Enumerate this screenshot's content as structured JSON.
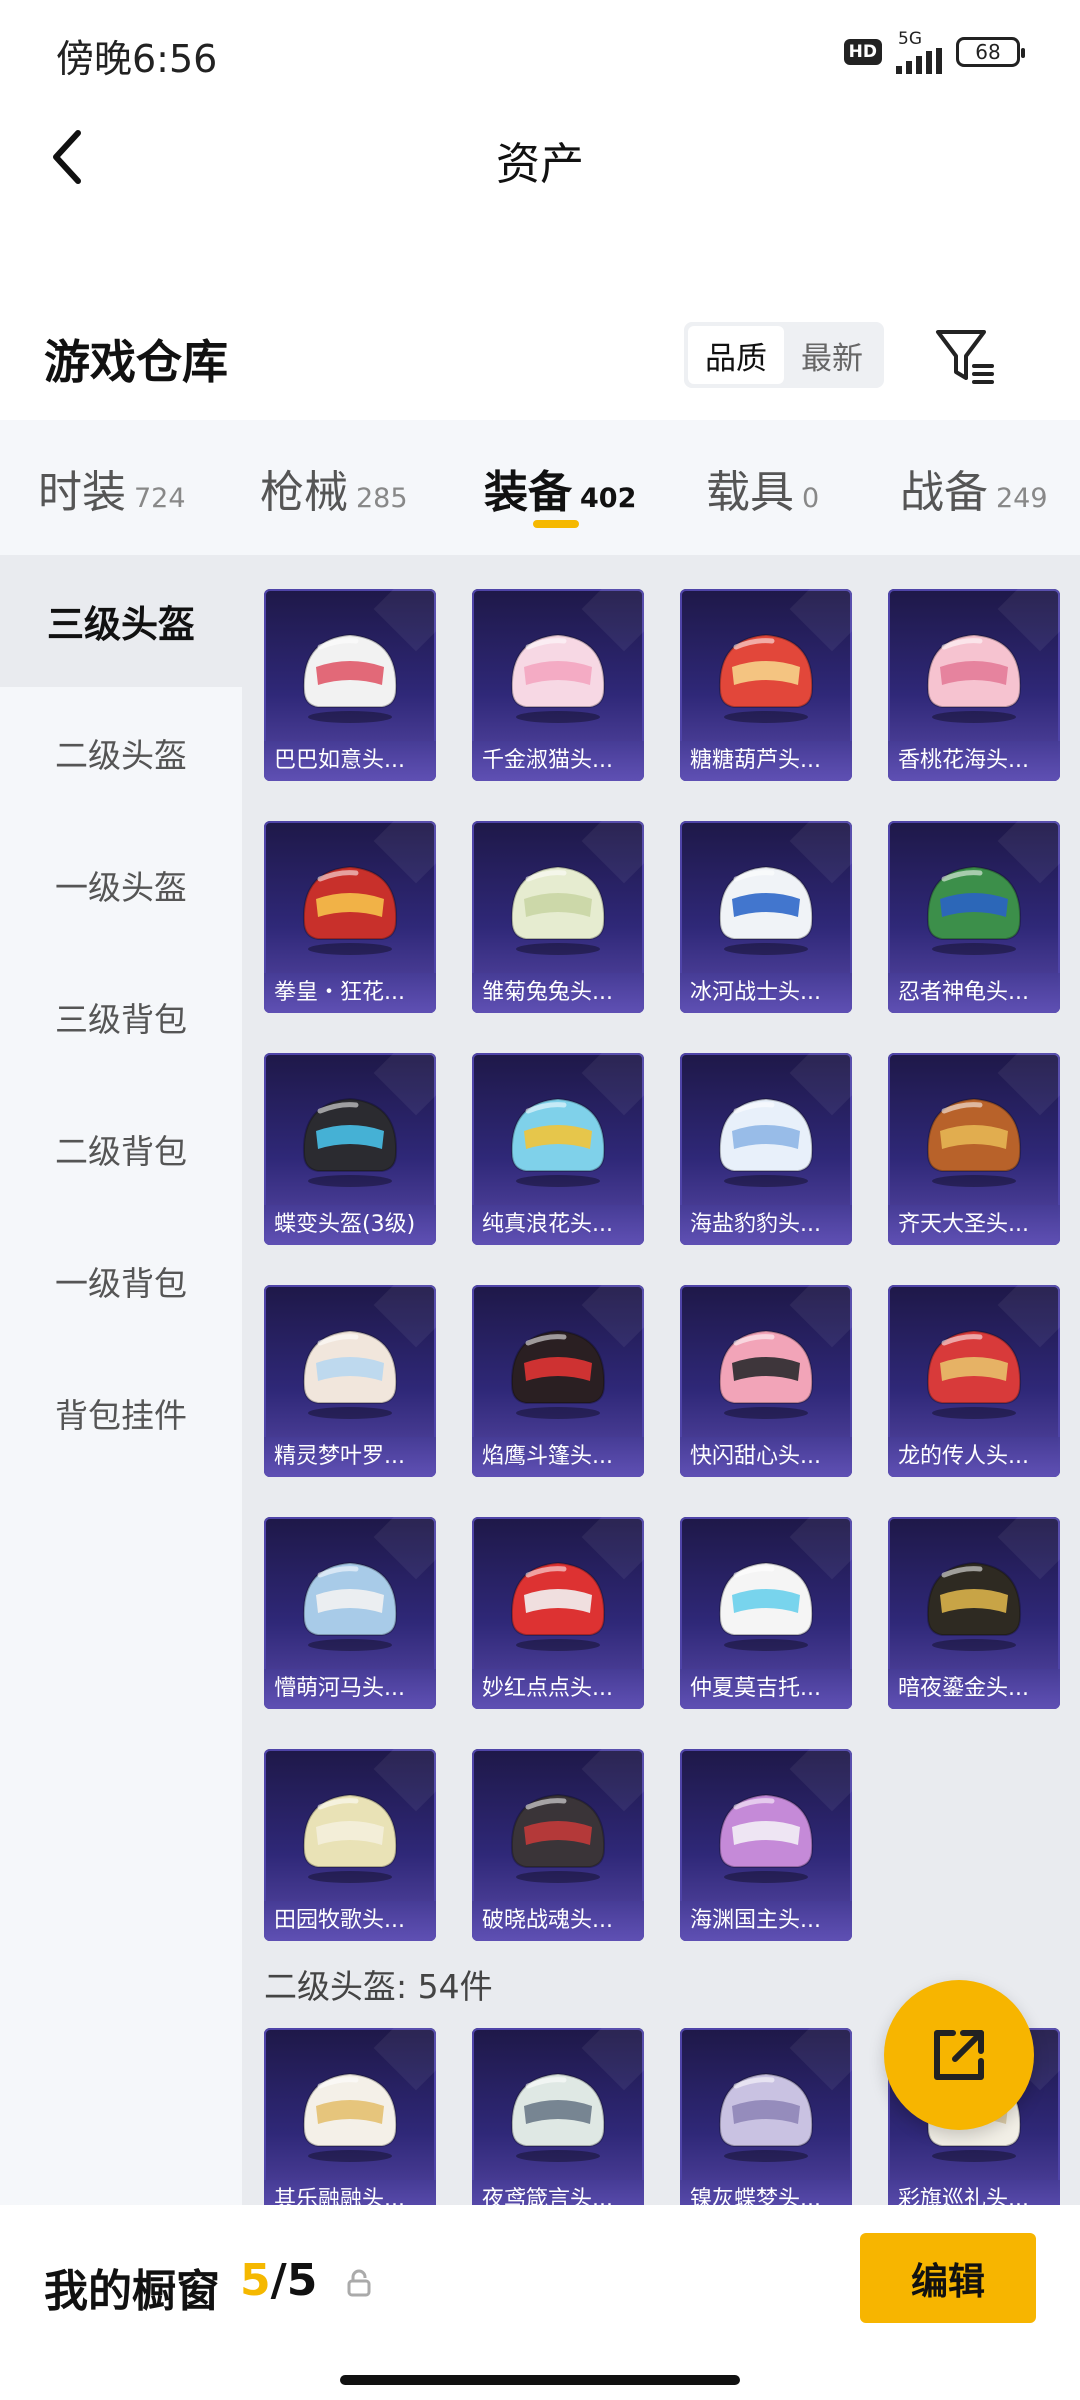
{
  "status_bar": {
    "time": "傍晚6:56",
    "hd": "HD",
    "network": "5G",
    "battery": "68"
  },
  "header": {
    "title": "资产"
  },
  "warehouse": {
    "title": "游戏仓库",
    "sort_options": [
      "品质",
      "最新"
    ],
    "active_sort": "品质"
  },
  "category_tabs": [
    {
      "label": "时装",
      "count": "724"
    },
    {
      "label": "枪械",
      "count": "285"
    },
    {
      "label": "装备",
      "count": "402",
      "active": true
    },
    {
      "label": "载具",
      "count": "0"
    },
    {
      "label": "战备",
      "count": "249"
    }
  ],
  "sidebar": {
    "items": [
      {
        "label": "三级头盔",
        "active": true
      },
      {
        "label": "二级头盔"
      },
      {
        "label": "一级头盔"
      },
      {
        "label": "三级背包"
      },
      {
        "label": "二级背包"
      },
      {
        "label": "一级背包"
      },
      {
        "label": "背包挂件"
      }
    ]
  },
  "items": [
    {
      "name": "巴巴如意头...",
      "color": "#f2f2f2",
      "accent": "#e05a6a"
    },
    {
      "name": "千金淑猫头...",
      "color": "#f7d8e4",
      "accent": "#f3a6c0"
    },
    {
      "name": "糖糖葫芦头...",
      "color": "#e2473a",
      "accent": "#f6d28a"
    },
    {
      "name": "香桃花海头...",
      "color": "#f6c3d0",
      "accent": "#e47c98"
    },
    {
      "name": "拳皇・狂花...",
      "color": "#c8302b",
      "accent": "#f5c14a"
    },
    {
      "name": "雏菊兔兔头...",
      "color": "#e6ecd0",
      "accent": "#c9d6a4"
    },
    {
      "name": "冰河战士头...",
      "color": "#f0f3f7",
      "accent": "#2f68c9"
    },
    {
      "name": "忍者神龟头...",
      "color": "#3c8f4a",
      "accent": "#2a63c4"
    },
    {
      "name": "蝶变头盔(3级)",
      "color": "#2b2b30",
      "accent": "#48c0e8"
    },
    {
      "name": "纯真浪花头...",
      "color": "#7fd1ea",
      "accent": "#f2c43a"
    },
    {
      "name": "海盐豹豹头...",
      "color": "#e8f0fa",
      "accent": "#8fb6e6"
    },
    {
      "name": "齐天大圣头...",
      "color": "#b8622a",
      "accent": "#e6b653"
    },
    {
      "name": "精灵梦叶罗...",
      "color": "#f1e6dc",
      "accent": "#b8d7f0"
    },
    {
      "name": "焰鹰斗篷头...",
      "color": "#2a1f22",
      "accent": "#e03434"
    },
    {
      "name": "快闪甜心头...",
      "color": "#f2a4b8",
      "accent": "#2a2a2e"
    },
    {
      "name": "龙的传人头...",
      "color": "#d83a3a",
      "accent": "#e8c06a"
    },
    {
      "name": "懵萌河马头...",
      "color": "#a8cbe8",
      "accent": "#f2f2f2"
    },
    {
      "name": "妙红点点头...",
      "color": "#dd3232",
      "accent": "#f2f2f2"
    },
    {
      "name": "仲夏莫吉托...",
      "color": "#f5f5f5",
      "accent": "#6ad0ec"
    },
    {
      "name": "暗夜鎏金头...",
      "color": "#2e2a22",
      "accent": "#d9b14a"
    },
    {
      "name": "田园牧歌头...",
      "color": "#e9e2b6",
      "accent": "#f4f0dc"
    },
    {
      "name": "破晓战魂头...",
      "color": "#3a3438",
      "accent": "#c23a3a"
    },
    {
      "name": "海渊国主头...",
      "color": "#c58ad8",
      "accent": "#f2eef6"
    }
  ],
  "section_level2": {
    "title": "二级头盔: 54件"
  },
  "items_level2": [
    {
      "name": "其乐融融头...",
      "color": "#f4f0e8",
      "accent": "#e4c070"
    },
    {
      "name": "夜鸢箴言头...",
      "color": "#dfe8e4",
      "accent": "#6c7a88"
    },
    {
      "name": "镍灰蝶梦头...",
      "color": "#c9c2e2",
      "accent": "#8f86b8"
    },
    {
      "name": "彩旗巡礼头...",
      "color": "#f2efe6",
      "accent": "#d8c6a0"
    }
  ],
  "bottom_bar": {
    "label": "我的橱窗",
    "current": "5",
    "separator": "/",
    "total": "5",
    "edit_label": "编辑"
  },
  "colors": {
    "accent": "#f5b800",
    "card_dark": "#1e1848",
    "card_light": "#5a4aa8"
  },
  "icons": [
    "back-arrow-icon",
    "filter-icon",
    "lock-icon",
    "share-icon"
  ]
}
